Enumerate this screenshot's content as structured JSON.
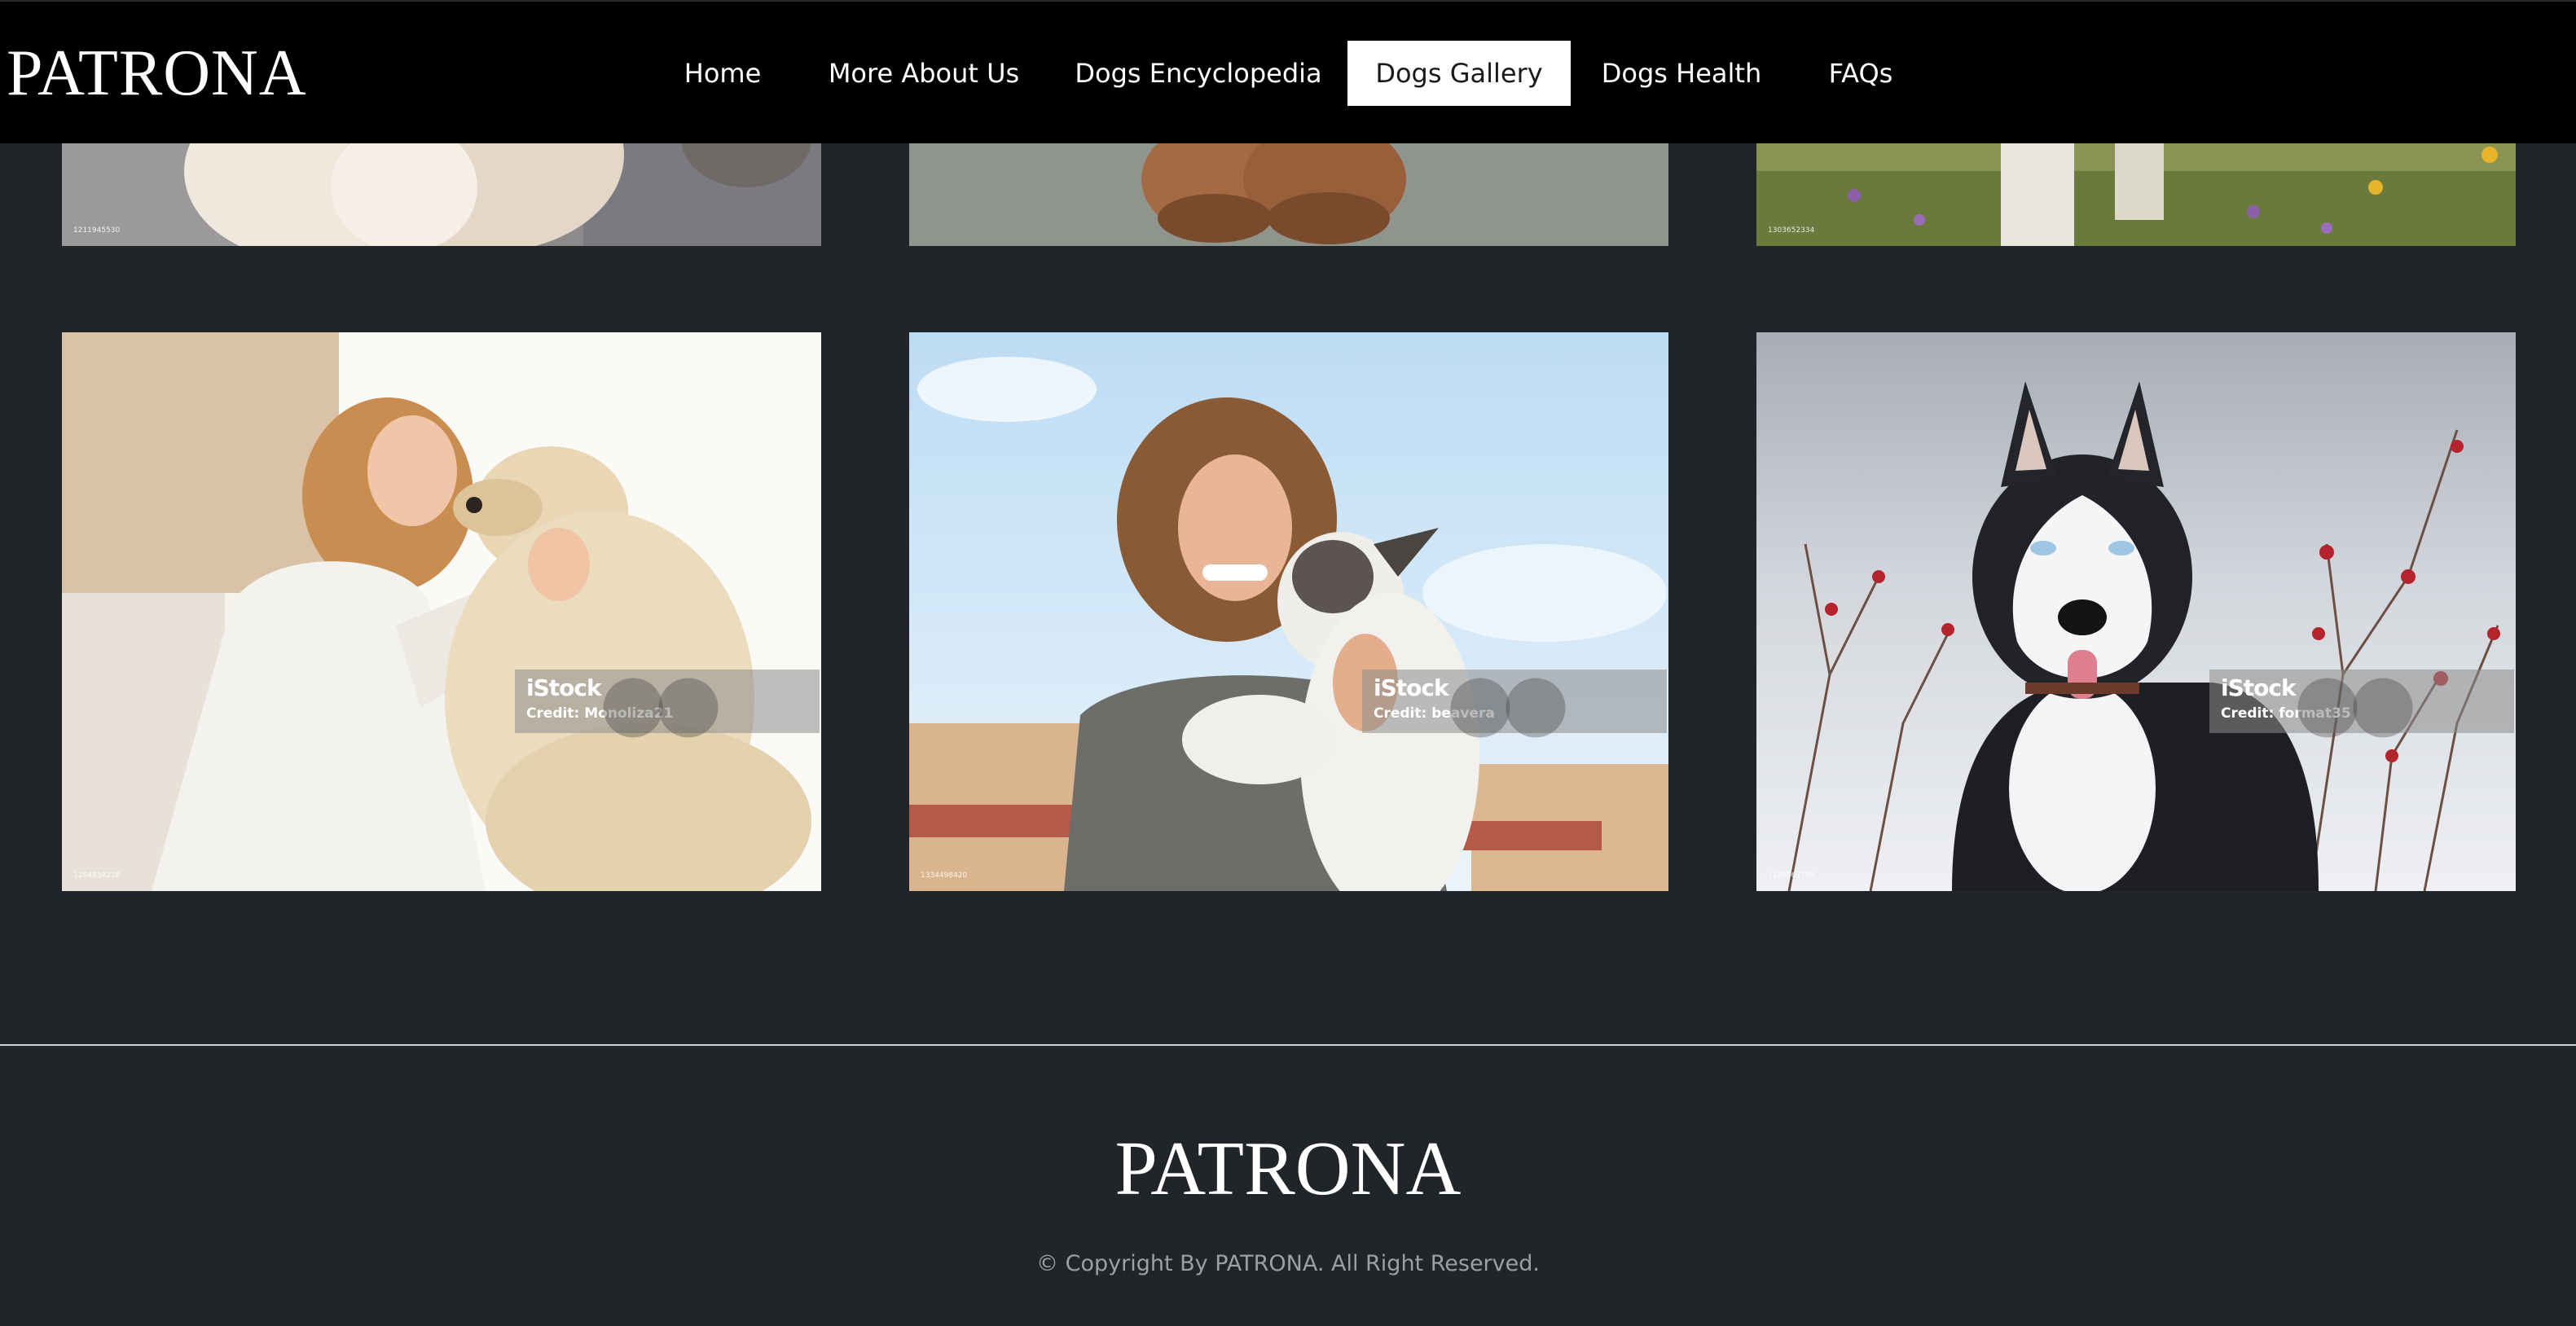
{
  "header": {
    "brand": "PATRONA",
    "nav": [
      {
        "label": "Home"
      },
      {
        "label": "More About Us"
      },
      {
        "label": "Dogs Encyclopedia"
      },
      {
        "label": "Dogs Gallery",
        "active": true
      },
      {
        "label": "Dogs Health"
      },
      {
        "label": "FAQs"
      }
    ]
  },
  "gallery": {
    "top_row": [
      {
        "image_id": "1211945530"
      },
      {
        "image_id": ""
      },
      {
        "image_id": "1303652334"
      }
    ],
    "row": [
      {
        "watermark": "iStock",
        "credit": "Credit: Monoliza21",
        "image_id": "1204834238",
        "alt": "woman touching foreheads with golden retriever"
      },
      {
        "watermark": "iStock",
        "credit": "Credit: beavera",
        "image_id": "1334498420",
        "alt": "smiling woman hugging french bulldog"
      },
      {
        "watermark": "iStock",
        "credit": "Credit: format35",
        "image_id": "1138067738",
        "alt": "husky in snowy rosehip bushes"
      }
    ]
  },
  "footer": {
    "brand": "PATRONA",
    "copyright": "© Copyright By PATRONA. All Right Reserved."
  },
  "colors": {
    "page_bg": "#212429",
    "header_bg": "#000000",
    "active_nav_bg": "#ffffff",
    "text": "#ffffff",
    "muted_text": "#9aa0a6"
  }
}
